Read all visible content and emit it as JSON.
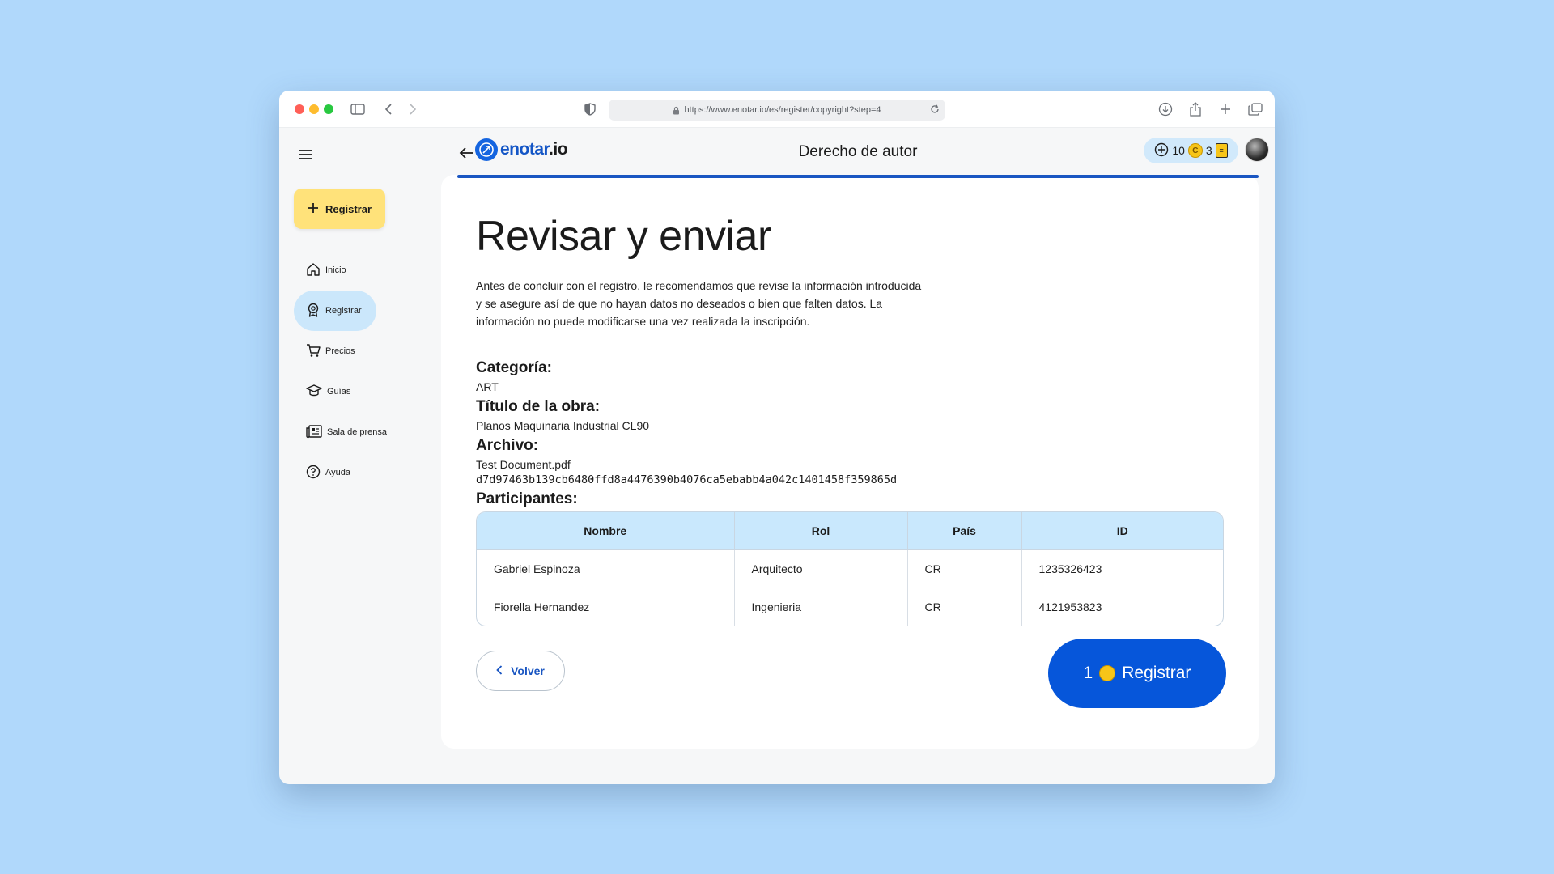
{
  "browser": {
    "url": "https://www.enotar.io/es/register/copyright?step=4"
  },
  "sidebar": {
    "register_button": "Registrar",
    "items": [
      {
        "label": "Inicio",
        "icon": "home-icon"
      },
      {
        "label": "Registrar",
        "icon": "badge-icon",
        "active": true
      },
      {
        "label": "Precios",
        "icon": "cart-icon"
      },
      {
        "label": "Guías",
        "icon": "graduation-cap-icon"
      },
      {
        "label": "Sala de prensa",
        "icon": "newspaper-icon"
      },
      {
        "label": "Ayuda",
        "icon": "help-icon"
      }
    ]
  },
  "header": {
    "logo_main": "enotar",
    "logo_tld": ".io",
    "title": "Derecho de autor",
    "credits": "10",
    "coins": "3"
  },
  "main": {
    "title": "Revisar y enviar",
    "intro": "Antes de concluir con el registro, le recomendamos que revise la información introducida y se asegure así de que no hayan datos no deseados o bien que falten datos. La información no puede modificarse una vez realizada la inscripción.",
    "category_label": "Categoría:",
    "category_value": "ART",
    "work_title_label": "Título de la obra:",
    "work_title_value": "Planos Maquinaria Industrial CL90",
    "file_label": "Archivo:",
    "file_name": "Test Document.pdf",
    "file_hash": "d7d97463b139cb6480ffd8a4476390b4076ca5ebabb4a042c1401458f359865d",
    "participants_label": "Participantes:",
    "table": {
      "headers": [
        "Nombre",
        "Rol",
        "País",
        "ID"
      ],
      "rows": [
        [
          "Gabriel Espinoza",
          "Arquitecto",
          "CR",
          "1235326423"
        ],
        [
          "Fiorella Hernandez",
          "Ingenieria",
          "CR",
          "4121953823"
        ]
      ]
    },
    "back_button": "Volver",
    "submit_cost": "1",
    "submit_label": "Registrar"
  },
  "colors": {
    "background": "#b0d8fb",
    "primary": "#0656da",
    "register_button": "#ffe27a",
    "active_nav": "#cbe7fb",
    "table_header": "#c9e8fd"
  }
}
